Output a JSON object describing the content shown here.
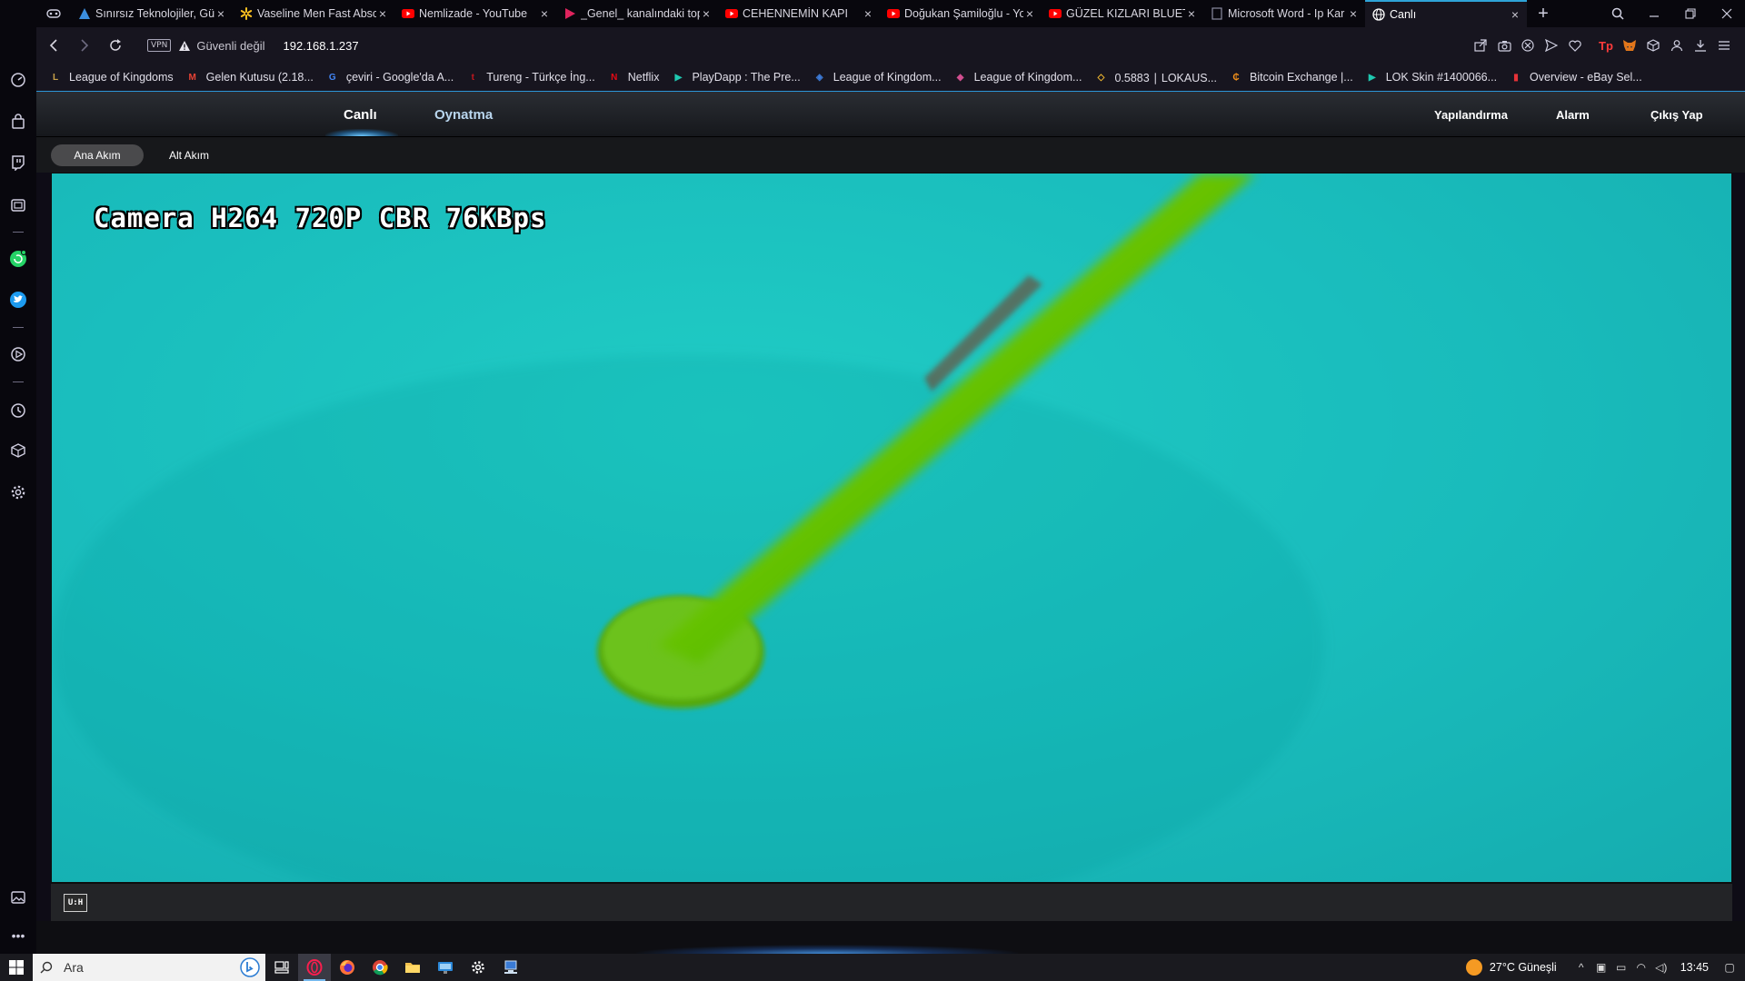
{
  "browser": {
    "tabs": [
      {
        "label": "Sınırsız Teknolojiler, Gü",
        "icon": "triangle-icon",
        "color": "#3b8ede"
      },
      {
        "label": "Vaseline Men Fast Abso",
        "icon": "walmart-icon",
        "color": "#ffc220"
      },
      {
        "label": "Nemlizade - YouTube",
        "icon": "youtube-icon",
        "color": "#ff0000"
      },
      {
        "label": "_Genel_ kanalındaki top",
        "icon": "play-icon",
        "color": "#e0245e"
      },
      {
        "label": "CEHENNEMİN KAPI",
        "icon": "youtube-icon",
        "color": "#ff0000"
      },
      {
        "label": "Doğukan Şamiloğlu - Yo",
        "icon": "youtube-icon",
        "color": "#ff0000"
      },
      {
        "label": "GÜZEL KIZLARI BLUETO",
        "icon": "youtube-icon",
        "color": "#ff0000"
      },
      {
        "label": "Microsoft Word - Ip Kar",
        "icon": "document-icon",
        "color": "#8a8aa0"
      },
      {
        "label": "Canlı",
        "icon": "globe-icon",
        "color": "#ffffff",
        "active": true
      }
    ],
    "address": {
      "vpn": "VPN",
      "security_text": "Güvenli değil",
      "url": "192.168.1.237"
    },
    "bookmarks": [
      {
        "label": "League of Kingdoms",
        "icon": "lok-icon",
        "glyph": "L",
        "color": "#c9a24a"
      },
      {
        "label": "Gelen Kutusu (2.18...",
        "icon": "gmail-icon",
        "glyph": "M",
        "color": "#ea4335"
      },
      {
        "label": "çeviri - Google'da A...",
        "icon": "google-icon",
        "glyph": "G",
        "color": "#4285f4"
      },
      {
        "label": "Tureng - Türkçe İng...",
        "icon": "tureng-icon",
        "glyph": "t",
        "color": "#c4171f"
      },
      {
        "label": "Netflix",
        "icon": "netflix-icon",
        "glyph": "N",
        "color": "#e50914"
      },
      {
        "label": "PlayDapp : The Pre...",
        "icon": "playdapp-icon",
        "glyph": "▶",
        "color": "#1fc8b0"
      },
      {
        "label": "League of Kingdom...",
        "icon": "lok-blue-icon",
        "glyph": "◈",
        "color": "#3d7bd8"
      },
      {
        "label": "League of Kingdom...",
        "icon": "lok-pink-icon",
        "glyph": "◆",
        "color": "#d04e8f"
      },
      {
        "label": "0.5883 ∣ LOKAUS...",
        "icon": "binance-icon",
        "glyph": "◇",
        "color": "#f3ba2f"
      },
      {
        "label": "Bitcoin Exchange |...",
        "icon": "bitcoin-icon",
        "glyph": "₵",
        "color": "#f7931a"
      },
      {
        "label": "LOK Skin #1400066...",
        "icon": "playdapp-icon",
        "glyph": "▶",
        "color": "#1fc8b0"
      },
      {
        "label": "Overview - eBay Sel...",
        "icon": "ebay-icon",
        "glyph": "▮",
        "color": "#e53238"
      }
    ]
  },
  "camera_ui": {
    "nav": {
      "live": "Canlı",
      "playback": "Oynatma",
      "config": "Yapılandırma",
      "alarm": "Alarm",
      "logout": "Çıkış Yap"
    },
    "streams": {
      "main": "Ana Akım",
      "sub": "Alt Akım"
    },
    "osd": "Camera H264 720P CBR 76KBps",
    "hd_label": "U:H"
  },
  "taskbar": {
    "search_placeholder": "Ara",
    "weather": "27°C  Güneşli",
    "time": "13:45"
  }
}
